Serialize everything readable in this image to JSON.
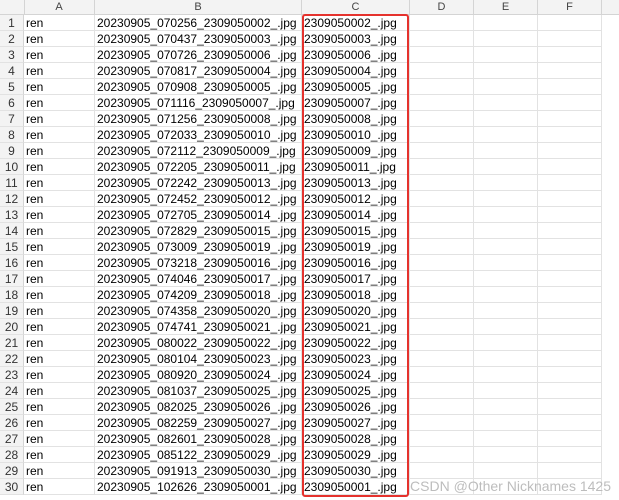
{
  "columns": [
    "A",
    "B",
    "C",
    "D",
    "E",
    "F"
  ],
  "rows": [
    {
      "num": "1",
      "a": "ren",
      "b": "20230905_070256_2309050002_.jpg",
      "c": "2309050002_.jpg"
    },
    {
      "num": "2",
      "a": "ren",
      "b": "20230905_070437_2309050003_.jpg",
      "c": "2309050003_.jpg"
    },
    {
      "num": "3",
      "a": "ren",
      "b": "20230905_070726_2309050006_.jpg",
      "c": "2309050006_.jpg"
    },
    {
      "num": "4",
      "a": "ren",
      "b": "20230905_070817_2309050004_.jpg",
      "c": "2309050004_.jpg"
    },
    {
      "num": "5",
      "a": "ren",
      "b": "20230905_070908_2309050005_.jpg",
      "c": "2309050005_.jpg"
    },
    {
      "num": "6",
      "a": "ren",
      "b": "20230905_071116_2309050007_.jpg",
      "c": "2309050007_.jpg"
    },
    {
      "num": "7",
      "a": "ren",
      "b": "20230905_071256_2309050008_.jpg",
      "c": "2309050008_.jpg"
    },
    {
      "num": "8",
      "a": "ren",
      "b": "20230905_072033_2309050010_.jpg",
      "c": "2309050010_.jpg"
    },
    {
      "num": "9",
      "a": "ren",
      "b": "20230905_072112_2309050009_.jpg",
      "c": "2309050009_.jpg"
    },
    {
      "num": "10",
      "a": "ren",
      "b": "20230905_072205_2309050011_.jpg",
      "c": "2309050011_.jpg"
    },
    {
      "num": "11",
      "a": "ren",
      "b": "20230905_072242_2309050013_.jpg",
      "c": "2309050013_.jpg"
    },
    {
      "num": "12",
      "a": "ren",
      "b": "20230905_072452_2309050012_.jpg",
      "c": "2309050012_.jpg"
    },
    {
      "num": "13",
      "a": "ren",
      "b": "20230905_072705_2309050014_.jpg",
      "c": "2309050014_.jpg"
    },
    {
      "num": "14",
      "a": "ren",
      "b": "20230905_072829_2309050015_.jpg",
      "c": "2309050015_.jpg"
    },
    {
      "num": "15",
      "a": "ren",
      "b": "20230905_073009_2309050019_.jpg",
      "c": "2309050019_.jpg"
    },
    {
      "num": "16",
      "a": "ren",
      "b": "20230905_073218_2309050016_.jpg",
      "c": "2309050016_.jpg"
    },
    {
      "num": "17",
      "a": "ren",
      "b": "20230905_074046_2309050017_.jpg",
      "c": "2309050017_.jpg"
    },
    {
      "num": "18",
      "a": "ren",
      "b": "20230905_074209_2309050018_.jpg",
      "c": "2309050018_.jpg"
    },
    {
      "num": "19",
      "a": "ren",
      "b": "20230905_074358_2309050020_.jpg",
      "c": "2309050020_.jpg"
    },
    {
      "num": "20",
      "a": "ren",
      "b": "20230905_074741_2309050021_.jpg",
      "c": "2309050021_.jpg"
    },
    {
      "num": "21",
      "a": "ren",
      "b": "20230905_080022_2309050022_.jpg",
      "c": "2309050022_.jpg"
    },
    {
      "num": "22",
      "a": "ren",
      "b": "20230905_080104_2309050023_.jpg",
      "c": "2309050023_.jpg"
    },
    {
      "num": "23",
      "a": "ren",
      "b": "20230905_080920_2309050024_.jpg",
      "c": "2309050024_.jpg"
    },
    {
      "num": "24",
      "a": "ren",
      "b": "20230905_081037_2309050025_.jpg",
      "c": "2309050025_.jpg"
    },
    {
      "num": "25",
      "a": "ren",
      "b": "20230905_082025_2309050026_.jpg",
      "c": "2309050026_.jpg"
    },
    {
      "num": "26",
      "a": "ren",
      "b": "20230905_082259_2309050027_.jpg",
      "c": "2309050027_.jpg"
    },
    {
      "num": "27",
      "a": "ren",
      "b": "20230905_082601_2309050028_.jpg",
      "c": "2309050028_.jpg"
    },
    {
      "num": "28",
      "a": "ren",
      "b": "20230905_085122_2309050029_.jpg",
      "c": "2309050029_.jpg"
    },
    {
      "num": "29",
      "a": "ren",
      "b": "20230905_091913_2309050030_.jpg",
      "c": "2309050030_.jpg"
    },
    {
      "num": "30",
      "a": "ren",
      "b": "20230905_102626_2309050001_.jpg",
      "c": "2309050001_.jpg"
    }
  ],
  "highlight_color": "#e5322d",
  "watermark": "CSDN @Other Nicknames 1425"
}
